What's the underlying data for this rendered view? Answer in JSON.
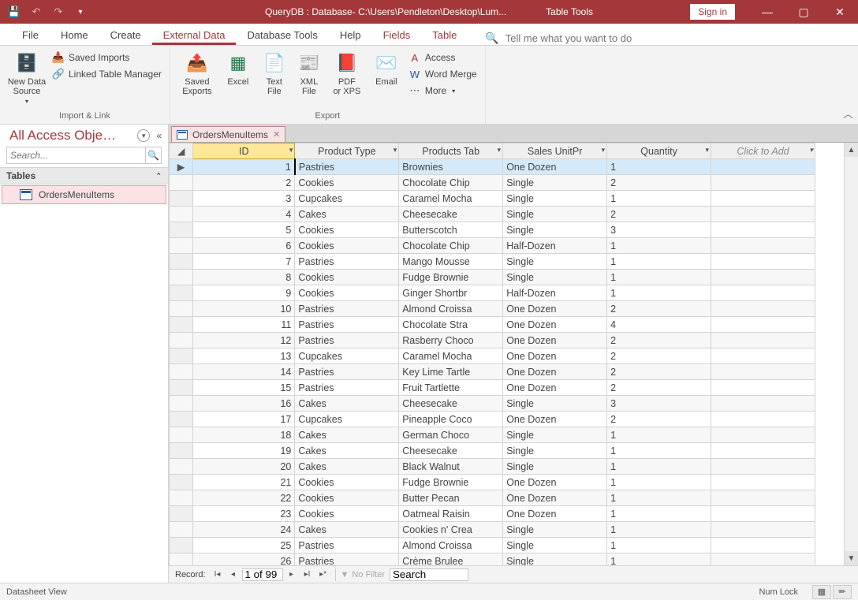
{
  "titlebar": {
    "title": "QueryDB : Database- C:\\Users\\Pendleton\\Desktop\\Lum...",
    "tool_title": "Table Tools",
    "signin": "Sign in"
  },
  "tabs": {
    "file": "File",
    "home": "Home",
    "create": "Create",
    "external": "External Data",
    "dbtools": "Database Tools",
    "help": "Help",
    "fields": "Fields",
    "table": "Table",
    "tellme_placeholder": "Tell me what you want to do"
  },
  "ribbon": {
    "group1_label": "Import & Link",
    "new_data_source": "New Data\nSource",
    "saved_imports": "Saved Imports",
    "linked_table_manager": "Linked Table Manager",
    "group2_label": "Export",
    "saved_exports": "Saved\nExports",
    "excel": "Excel",
    "text_file": "Text\nFile",
    "xml_file": "XML\nFile",
    "pdf_xps": "PDF\nor XPS",
    "email": "Email",
    "access": "Access",
    "word_merge": "Word Merge",
    "more": "More"
  },
  "nav": {
    "title": "All Access Obje…",
    "search_placeholder": "Search...",
    "group": "Tables",
    "item1": "OrdersMenuItems"
  },
  "tab": {
    "name": "OrdersMenuItems"
  },
  "grid": {
    "headers": [
      "ID",
      "Product Type",
      "Products Tab",
      "Sales UnitPr",
      "Quantity",
      "Click to Add"
    ],
    "rows": [
      {
        "id": 1,
        "pt": "Pastries",
        "pn": "Brownies",
        "su": "One Dozen",
        "q": 1
      },
      {
        "id": 2,
        "pt": "Cookies",
        "pn": "Chocolate Chip",
        "su": "Single",
        "q": 2
      },
      {
        "id": 3,
        "pt": "Cupcakes",
        "pn": "Caramel Mocha",
        "su": "Single",
        "q": 1
      },
      {
        "id": 4,
        "pt": "Cakes",
        "pn": "Cheesecake",
        "su": "Single",
        "q": 2
      },
      {
        "id": 5,
        "pt": "Cookies",
        "pn": "Butterscotch",
        "su": "Single",
        "q": 3
      },
      {
        "id": 6,
        "pt": "Cookies",
        "pn": "Chocolate Chip",
        "su": "Half-Dozen",
        "q": 1
      },
      {
        "id": 7,
        "pt": "Pastries",
        "pn": "Mango Mousse",
        "su": "Single",
        "q": 1
      },
      {
        "id": 8,
        "pt": "Cookies",
        "pn": "Fudge Brownie",
        "su": "Single",
        "q": 1
      },
      {
        "id": 9,
        "pt": "Cookies",
        "pn": "Ginger Shortbr",
        "su": "Half-Dozen",
        "q": 1
      },
      {
        "id": 10,
        "pt": "Pastries",
        "pn": "Almond Croissa",
        "su": "One Dozen",
        "q": 2
      },
      {
        "id": 11,
        "pt": "Pastries",
        "pn": "Chocolate Stra",
        "su": "One Dozen",
        "q": 4
      },
      {
        "id": 12,
        "pt": "Pastries",
        "pn": "Rasberry Choco",
        "su": "One Dozen",
        "q": 2
      },
      {
        "id": 13,
        "pt": "Cupcakes",
        "pn": "Caramel Mocha",
        "su": "One Dozen",
        "q": 2
      },
      {
        "id": 14,
        "pt": "Pastries",
        "pn": "Key Lime Tartle",
        "su": "One Dozen",
        "q": 2
      },
      {
        "id": 15,
        "pt": "Pastries",
        "pn": "Fruit Tartlette",
        "su": "One Dozen",
        "q": 2
      },
      {
        "id": 16,
        "pt": "Cakes",
        "pn": "Cheesecake",
        "su": "Single",
        "q": 3
      },
      {
        "id": 17,
        "pt": "Cupcakes",
        "pn": "Pineapple Coco",
        "su": "One Dozen",
        "q": 2
      },
      {
        "id": 18,
        "pt": "Cakes",
        "pn": "German Choco",
        "su": "Single",
        "q": 1
      },
      {
        "id": 19,
        "pt": "Cakes",
        "pn": "Cheesecake",
        "su": "Single",
        "q": 1
      },
      {
        "id": 20,
        "pt": "Cakes",
        "pn": "Black Walnut",
        "su": "Single",
        "q": 1
      },
      {
        "id": 21,
        "pt": "Cookies",
        "pn": "Fudge Brownie",
        "su": "One Dozen",
        "q": 1
      },
      {
        "id": 22,
        "pt": "Cookies",
        "pn": "Butter Pecan",
        "su": "One Dozen",
        "q": 1
      },
      {
        "id": 23,
        "pt": "Cookies",
        "pn": "Oatmeal Raisin",
        "su": "One Dozen",
        "q": 1
      },
      {
        "id": 24,
        "pt": "Cakes",
        "pn": "Cookies n' Crea",
        "su": "Single",
        "q": 1
      },
      {
        "id": 25,
        "pt": "Pastries",
        "pn": "Almond Croissa",
        "su": "Single",
        "q": 1
      },
      {
        "id": 26,
        "pt": "Pastries",
        "pn": "Crème Brulee",
        "su": "Single",
        "q": 1
      }
    ]
  },
  "recnav": {
    "label": "Record:",
    "pos": "1 of 99",
    "no_filter": "No Filter",
    "search": "Search"
  },
  "status": {
    "left": "Datasheet View",
    "numlock": "Num Lock"
  }
}
